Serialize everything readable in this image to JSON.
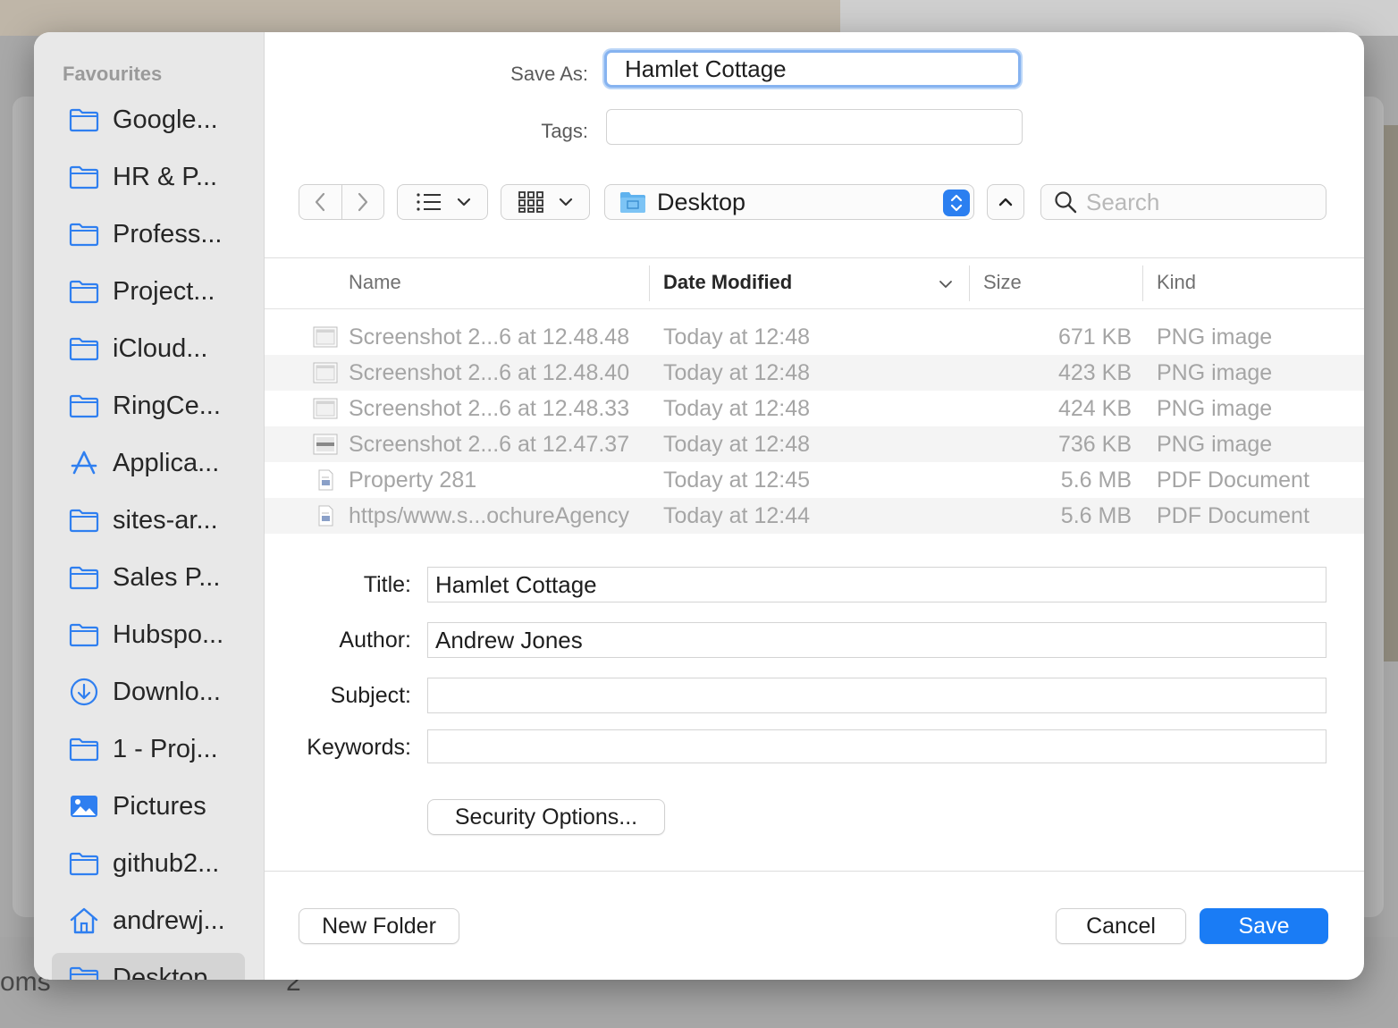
{
  "background": {
    "bottom_left_text": "oms",
    "bottom_mid_text": "2"
  },
  "sidebar": {
    "heading": "Favourites",
    "items": [
      {
        "label": "Google...",
        "icon": "folder-icon"
      },
      {
        "label": "HR & P...",
        "icon": "folder-icon"
      },
      {
        "label": "Profess...",
        "icon": "folder-icon"
      },
      {
        "label": "Project...",
        "icon": "folder-icon"
      },
      {
        "label": "iCloud...",
        "icon": "folder-icon"
      },
      {
        "label": "RingCe...",
        "icon": "folder-icon"
      },
      {
        "label": "Applica...",
        "icon": "applications-icon"
      },
      {
        "label": "sites-ar...",
        "icon": "folder-icon"
      },
      {
        "label": "Sales P...",
        "icon": "folder-icon"
      },
      {
        "label": "Hubspo...",
        "icon": "folder-icon"
      },
      {
        "label": "Downlo...",
        "icon": "downloads-icon"
      },
      {
        "label": "1 - Proj...",
        "icon": "folder-icon"
      },
      {
        "label": "Pictures",
        "icon": "pictures-icon"
      },
      {
        "label": "github2...",
        "icon": "folder-icon"
      },
      {
        "label": "andrewj...",
        "icon": "home-icon"
      },
      {
        "label": "Desktop",
        "icon": "desktop-folder-icon",
        "selected": true
      }
    ]
  },
  "save_as": {
    "label": "Save As:",
    "value": "Hamlet Cottage"
  },
  "tags": {
    "label": "Tags:",
    "value": ""
  },
  "toolbar": {
    "location": "Desktop",
    "search_placeholder": "Search"
  },
  "columns": {
    "name": "Name",
    "date_modified": "Date Modified",
    "size": "Size",
    "kind": "Kind"
  },
  "files": [
    {
      "name": "Screenshot 2...6 at 12.48.48",
      "date": "Today at 12:48",
      "size": "671 KB",
      "kind": "PNG image",
      "type": "image"
    },
    {
      "name": "Screenshot 2...6 at 12.48.40",
      "date": "Today at 12:48",
      "size": "423 KB",
      "kind": "PNG image",
      "type": "image"
    },
    {
      "name": "Screenshot 2...6 at 12.48.33",
      "date": "Today at 12:48",
      "size": "424 KB",
      "kind": "PNG image",
      "type": "image"
    },
    {
      "name": "Screenshot 2...6 at 12.47.37",
      "date": "Today at 12:48",
      "size": "736 KB",
      "kind": "PNG image",
      "type": "image-dark"
    },
    {
      "name": "Property 281",
      "date": "Today at 12:45",
      "size": "5.6 MB",
      "kind": "PDF Document",
      "type": "pdf"
    },
    {
      "name": "https/www.s...ochureAgency",
      "date": "Today at 12:44",
      "size": "5.6 MB",
      "kind": "PDF Document",
      "type": "pdf"
    }
  ],
  "metadata": {
    "title_label": "Title:",
    "title_value": "Hamlet Cottage",
    "author_label": "Author:",
    "author_value": "Andrew Jones",
    "subject_label": "Subject:",
    "subject_value": "",
    "keywords_label": "Keywords:",
    "keywords_value": ""
  },
  "buttons": {
    "security_options": "Security Options...",
    "new_folder": "New Folder",
    "cancel": "Cancel",
    "save": "Save"
  },
  "colors": {
    "accent": "#1a7cf5",
    "sidebar_icon": "#2f7ff0"
  }
}
